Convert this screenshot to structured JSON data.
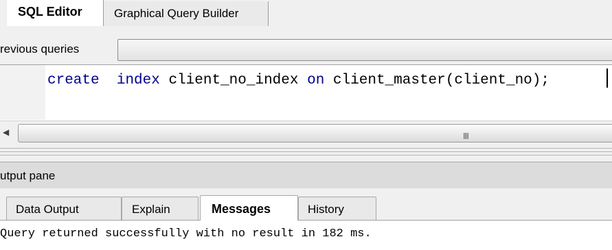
{
  "top_tabs": [
    {
      "label": "SQL Editor",
      "active": true
    },
    {
      "label": "Graphical Query Builder",
      "active": false
    }
  ],
  "previous_queries": {
    "label": "revious queries",
    "value": ""
  },
  "editor": {
    "code_tokens": [
      {
        "text": "create",
        "kind": "keyword"
      },
      {
        "text": "  ",
        "kind": "space"
      },
      {
        "text": "index",
        "kind": "keyword"
      },
      {
        "text": " client_no_index ",
        "kind": "identifier"
      },
      {
        "text": "on",
        "kind": "keyword"
      },
      {
        "text": " client_master(client_no);",
        "kind": "identifier"
      }
    ]
  },
  "scrollbar": {
    "left_arrow": "◀",
    "grip": "III"
  },
  "output_pane": {
    "title": "utput pane"
  },
  "output_tabs": [
    {
      "label": "Data Output",
      "active": false
    },
    {
      "label": "Explain",
      "active": false
    },
    {
      "label": "Messages",
      "active": true
    },
    {
      "label": "History",
      "active": false
    }
  ],
  "messages": {
    "text": "Query returned successfully with no result in 182 ms."
  },
  "colors": {
    "keyword": "#00008b",
    "background": "#f0f0f0"
  }
}
